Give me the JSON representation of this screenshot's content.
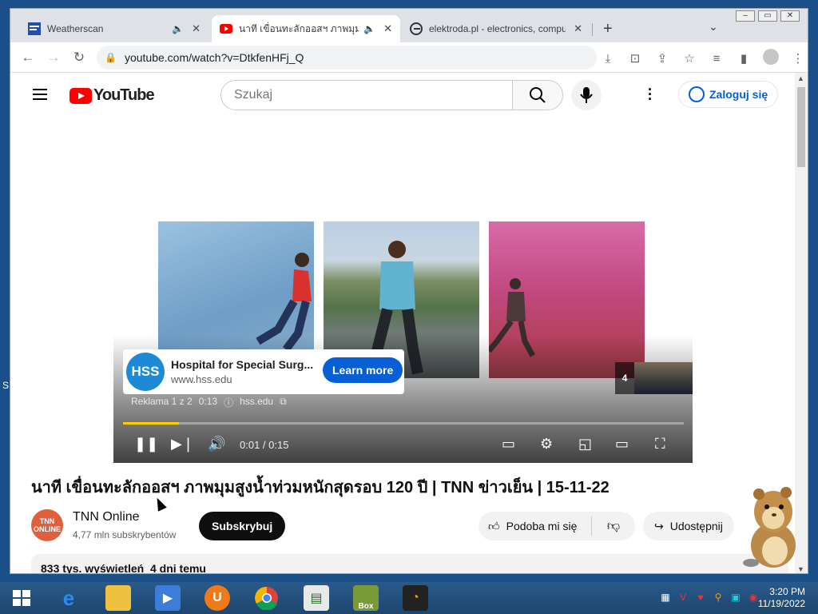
{
  "browser": {
    "tabs": [
      {
        "title": "Weatherscan",
        "favicon": "weather-channel-icon",
        "audio": true
      },
      {
        "title": "นาที เขื่อนทะลักออสฯ ภาพมุมสูงน้",
        "favicon": "youtube-icon",
        "audio": true
      },
      {
        "title": "elektroda.pl - electronics, compu",
        "favicon": "elektroda-icon",
        "audio": false
      }
    ],
    "address": "youtube.com/watch?v=DtkfenHFj_Q"
  },
  "youtube": {
    "logo_text": "YouTube",
    "search_placeholder": "Szukaj",
    "signin_label": "Zaloguj się"
  },
  "ad": {
    "logo_text": "HSS",
    "title": "Hospital for Special Surg...",
    "url": "www.hss.edu",
    "cta": "Learn more",
    "meta_label": "Reklama 1 z 2",
    "meta_time": "0:13",
    "meta_domain": "hss.edu",
    "next_count": "4"
  },
  "player": {
    "time": "0:01 / 0:15",
    "progress": 0.1,
    "accent": "#ffcc00"
  },
  "video": {
    "title": "นาที เขื่อนทะลักออสฯ ภาพมุมสูงน้ำท่วมหนักสุดรอบ 120 ปี | TNN ข่าวเย็น | 15-11-22",
    "channel_name": "TNN Online",
    "channel_avatar_line1": "TNN",
    "channel_avatar_line2": "ONLINE",
    "subscribers": "4,77 mln subskrybentów",
    "subscribe_label": "Subskrybuj",
    "like_label": "Podoba mi się",
    "share_label": "Udostępnij",
    "views": "833 tys. wyświetleń",
    "date": "4 dni temu"
  },
  "taskbar": {
    "time": "3:20 PM",
    "date": "11/19/2022",
    "gamebox_label": "Box"
  },
  "desktop": {
    "left_char": "S"
  }
}
